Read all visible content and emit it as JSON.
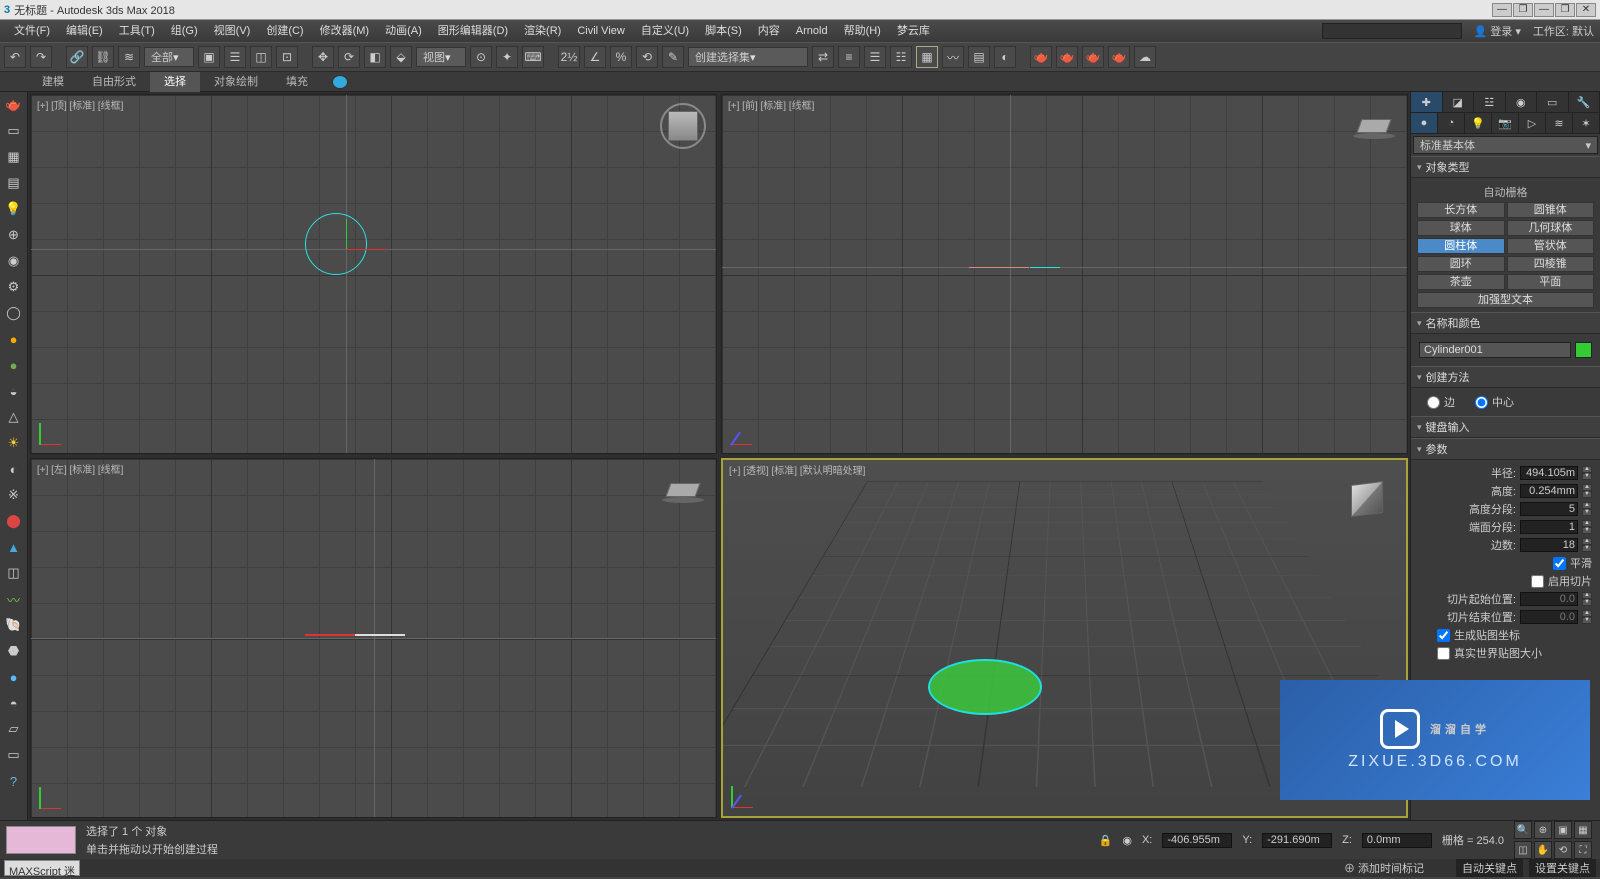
{
  "title": "无标题 - Autodesk 3ds Max 2018",
  "menu": [
    "文件(F)",
    "编辑(E)",
    "工具(T)",
    "组(G)",
    "视图(V)",
    "创建(C)",
    "修改器(M)",
    "动画(A)",
    "图形编辑器(D)",
    "渲染(R)",
    "Civil View",
    "自定义(U)",
    "脚本(S)",
    "内容",
    "Arnold",
    "帮助(H)",
    "梦云库"
  ],
  "login": "登录",
  "workspace_label": "工作区: 默认",
  "ribbon": {
    "tabs": [
      "建模",
      "自由形式",
      "选择",
      "对象绘制",
      "填充"
    ],
    "active": "选择"
  },
  "toolbar": {
    "combo_all": "全部",
    "combo_view": "视图",
    "combo_selset": "创建选择集"
  },
  "viewports": {
    "top": "[+] [顶] [标准] [线框]",
    "front": "[+] [前] [标准] [线框]",
    "left": "[+] [左] [标准] [线框]",
    "persp": "[+] [透视] [标准] [默认明暗处理]"
  },
  "cmd": {
    "dropdown": "标准基本体",
    "roll_objtype": "对象类型",
    "autogrid": "自动栅格",
    "prims": [
      "长方体",
      "圆锥体",
      "球体",
      "几何球体",
      "圆柱体",
      "管状体",
      "圆环",
      "四棱锥",
      "茶壶",
      "平面",
      "加强型文本"
    ],
    "prim_active": "圆柱体",
    "roll_namecolor": "名称和颜色",
    "objname": "Cylinder001",
    "roll_method": "创建方法",
    "method_edge": "边",
    "method_center": "中心",
    "roll_keyboard": "键盘输入",
    "roll_params": "参数",
    "p_radius_l": "半径:",
    "p_radius_v": "494.105m",
    "p_height_l": "高度:",
    "p_height_v": "0.254mm",
    "p_hseg_l": "高度分段:",
    "p_hseg_v": "5",
    "p_cseg_l": "端面分段:",
    "p_cseg_v": "1",
    "p_sides_l": "边数:",
    "p_sides_v": "18",
    "p_smooth": "平滑",
    "p_slice": "启用切片",
    "p_slicefrom_l": "切片起始位置:",
    "p_slicefrom_v": "0.0",
    "p_sliceto_l": "切片结束位置:",
    "p_sliceto_v": "0.0",
    "p_genmap": "生成贴图坐标",
    "p_realworld": "真实世界贴图大小"
  },
  "status": {
    "selected": "选择了 1 个 对象",
    "hint": "单击并拖动以开始创建过程",
    "maxscript": "MAXScript 迷",
    "x_l": "X:",
    "x_v": "-406.955m",
    "y_l": "Y:",
    "y_v": "-291.690m",
    "z_l": "Z:",
    "z_v": "0.0mm",
    "grid": "栅格 = 254.0",
    "addtime": "添加时间标记",
    "autokey": "自动关键点",
    "setkey": "设置关键点"
  },
  "watermark": {
    "main": "溜溜自学",
    "sub": "ZIXUE.3D66.COM"
  }
}
